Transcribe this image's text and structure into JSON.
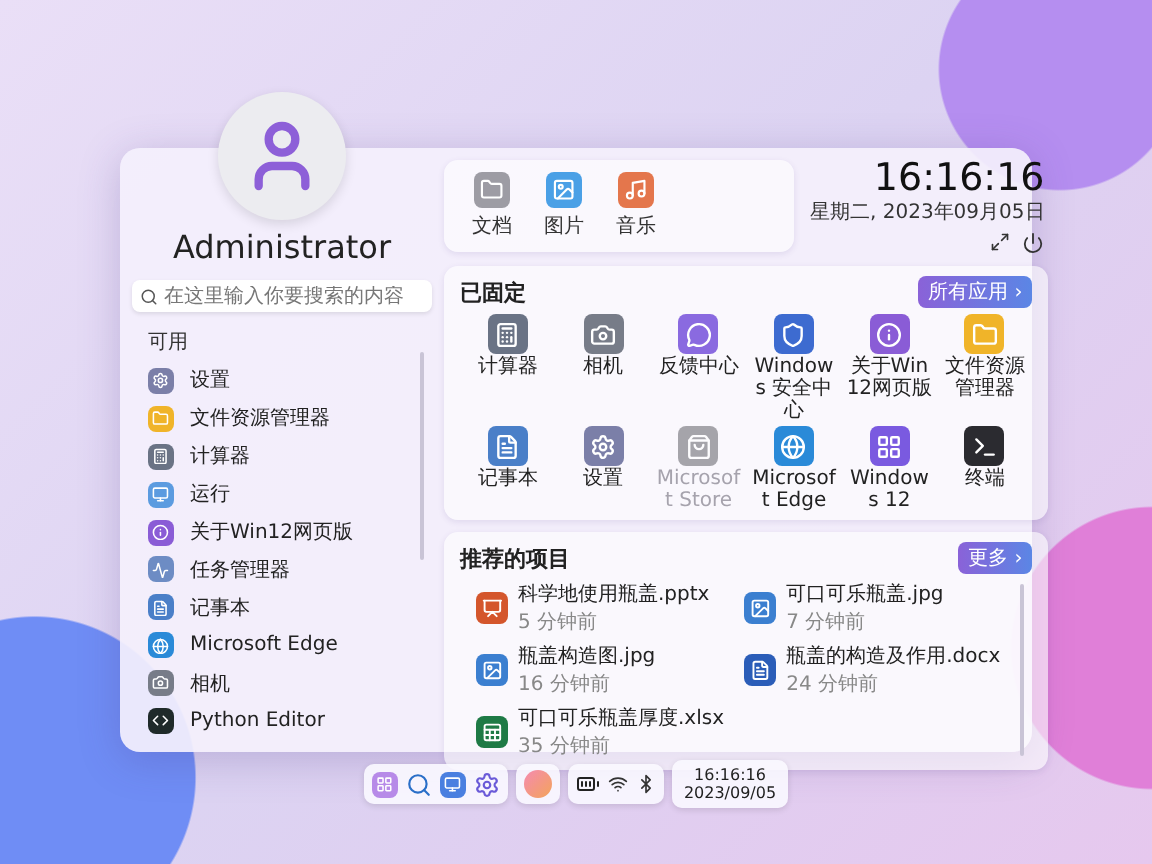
{
  "user": {
    "name": "Administrator"
  },
  "search": {
    "placeholder": "在这里输入你要搜索的内容"
  },
  "available": {
    "title": "可用",
    "items": [
      {
        "label": "设置"
      },
      {
        "label": "文件资源管理器"
      },
      {
        "label": "计算器"
      },
      {
        "label": "运行"
      },
      {
        "label": "关于Win12网页版"
      },
      {
        "label": "任务管理器"
      },
      {
        "label": "记事本"
      },
      {
        "label": "Microsoft Edge"
      },
      {
        "label": "相机"
      },
      {
        "label": "Python Editor"
      }
    ]
  },
  "quick_folders": [
    {
      "label": "文档"
    },
    {
      "label": "图片"
    },
    {
      "label": "音乐"
    }
  ],
  "clock": {
    "time": "16:16:16",
    "date": "星期二, 2023年09月05日"
  },
  "pinned": {
    "title": "已固定",
    "all_apps_button": "所有应用 ›",
    "apps": [
      {
        "label": "计算器",
        "disabled": false
      },
      {
        "label": "相机",
        "disabled": false
      },
      {
        "label": "反馈中心",
        "disabled": false
      },
      {
        "label": "Windows 安全中心",
        "disabled": false
      },
      {
        "label": "关于Win12网页版",
        "disabled": false
      },
      {
        "label": "文件资源管理器",
        "disabled": false
      },
      {
        "label": "记事本",
        "disabled": false
      },
      {
        "label": "设置",
        "disabled": false
      },
      {
        "label": "Microsoft Store",
        "disabled": true
      },
      {
        "label": "Microsoft Edge",
        "disabled": false
      },
      {
        "label": "Windows 12",
        "disabled": false
      },
      {
        "label": "终端",
        "disabled": false
      }
    ]
  },
  "recommended": {
    "title": "推荐的项目",
    "more_button": "更多 ›",
    "files": [
      {
        "name": "科学地使用瓶盖.pptx",
        "time": "5 分钟前"
      },
      {
        "name": "可口可乐瓶盖.jpg",
        "time": "7 分钟前"
      },
      {
        "name": "瓶盖构造图.jpg",
        "time": "16 分钟前"
      },
      {
        "name": "瓶盖的构造及作用.docx",
        "time": "24 分钟前"
      },
      {
        "name": "可口可乐瓶盖厚度.xlsx",
        "time": "35 分钟前"
      }
    ]
  },
  "taskbar": {
    "time": "16:16:16",
    "date": "2023/09/05"
  }
}
